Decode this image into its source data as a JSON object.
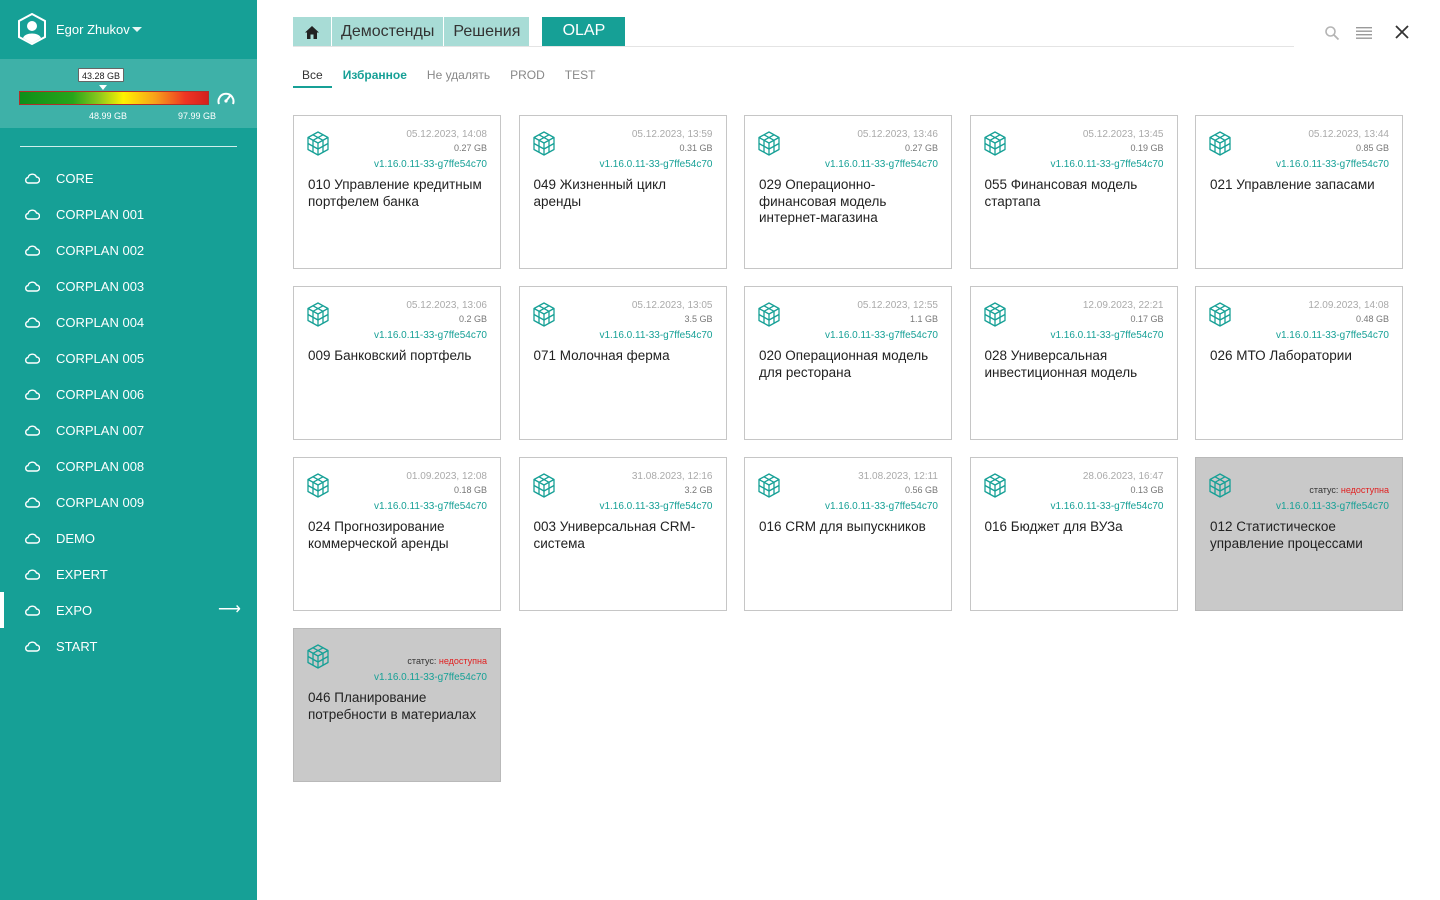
{
  "user": {
    "name": "Egor Zhukov"
  },
  "storage": {
    "used": "43.28 GB",
    "mid": "48.99 GB",
    "max": "97.99 GB",
    "used_fraction": 0.442
  },
  "colors": {
    "accent": "#16a096",
    "unavailable": "#e02020"
  },
  "sidebar": {
    "items": [
      {
        "label": "CORE"
      },
      {
        "label": "CORPLAN 001"
      },
      {
        "label": "CORPLAN 002"
      },
      {
        "label": "CORPLAN 003"
      },
      {
        "label": "CORPLAN 004"
      },
      {
        "label": "CORPLAN 005"
      },
      {
        "label": "CORPLAN 006"
      },
      {
        "label": "CORPLAN 007"
      },
      {
        "label": "CORPLAN 008"
      },
      {
        "label": "CORPLAN 009"
      },
      {
        "label": "DEMO"
      },
      {
        "label": "EXPERT"
      },
      {
        "label": "EXPO",
        "active": true,
        "arrow": "⟶"
      },
      {
        "label": "START"
      }
    ]
  },
  "breadcrumb": {
    "home_icon": "home-icon",
    "items": [
      "Демостенды",
      "Решения"
    ],
    "active": "OLAP"
  },
  "toolbar": {
    "icons": [
      "search-icon",
      "menu-icon",
      "close-icon"
    ]
  },
  "tabs": [
    {
      "label": "Все",
      "active": true
    },
    {
      "label": "Избранное",
      "fav": true
    },
    {
      "label": "Не удалять"
    },
    {
      "label": "PROD"
    },
    {
      "label": "TEST"
    }
  ],
  "status_label": "статус:",
  "status_unavailable": "недоступна",
  "cards": [
    {
      "date": "05.12.2023, 14:08",
      "size": "0.27 GB",
      "version": "v1.16.0.11-33-g7ffe54c70",
      "title": "010 Управление кредитным портфелем банка"
    },
    {
      "date": "05.12.2023, 13:59",
      "size": "0.31 GB",
      "version": "v1.16.0.11-33-g7ffe54c70",
      "title": "049 Жизненный цикл аренды"
    },
    {
      "date": "05.12.2023, 13:46",
      "size": "0.27 GB",
      "version": "v1.16.0.11-33-g7ffe54c70",
      "title": "029 Операционно-финансовая модель интернет-магазина"
    },
    {
      "date": "05.12.2023, 13:45",
      "size": "0.19 GB",
      "version": "v1.16.0.11-33-g7ffe54c70",
      "title": "055 Финансовая модель стартапа"
    },
    {
      "date": "05.12.2023, 13:44",
      "size": "0.85 GB",
      "version": "v1.16.0.11-33-g7ffe54c70",
      "title": "021 Управление запасами"
    },
    {
      "date": "05.12.2023, 13:06",
      "size": "0.2 GB",
      "version": "v1.16.0.11-33-g7ffe54c70",
      "title": "009 Банковский портфель"
    },
    {
      "date": "05.12.2023, 13:05",
      "size": "3.5 GB",
      "version": "v1.16.0.11-33-g7ffe54c70",
      "title": "071 Молочная ферма"
    },
    {
      "date": "05.12.2023, 12:55",
      "size": "1.1 GB",
      "version": "v1.16.0.11-33-g7ffe54c70",
      "title": "020 Операционная модель для ресторана"
    },
    {
      "date": "12.09.2023, 22:21",
      "size": "0.17 GB",
      "version": "v1.16.0.11-33-g7ffe54c70",
      "title": "028 Универсальная инвестиционная модель"
    },
    {
      "date": "12.09.2023, 14:08",
      "size": "0.48 GB",
      "version": "v1.16.0.11-33-g7ffe54c70",
      "title": "026 МТО Лаборатории"
    },
    {
      "date": "01.09.2023, 12:08",
      "size": "0.18 GB",
      "version": "v1.16.0.11-33-g7ffe54c70",
      "title": "024 Прогнозирование коммерческой аренды"
    },
    {
      "date": "31.08.2023, 12:16",
      "size": "3.2 GB",
      "version": "v1.16.0.11-33-g7ffe54c70",
      "title": "003 Универсальная CRM-система"
    },
    {
      "date": "31.08.2023, 12:11",
      "size": "0.56 GB",
      "version": "v1.16.0.11-33-g7ffe54c70",
      "title": "016 CRM для выпускников"
    },
    {
      "date": "28.06.2023, 16:47",
      "size": "0.13 GB",
      "version": "v1.16.0.11-33-g7ffe54c70",
      "title": "016 Бюджет для ВУЗа"
    },
    {
      "unavailable": true,
      "version": "v1.16.0.11-33-g7ffe54c70",
      "title": "012 Статистическое управление процессами"
    },
    {
      "unavailable": true,
      "version": "v1.16.0.11-33-g7ffe54c70",
      "title": "046 Планирование потребности в материалах"
    }
  ]
}
